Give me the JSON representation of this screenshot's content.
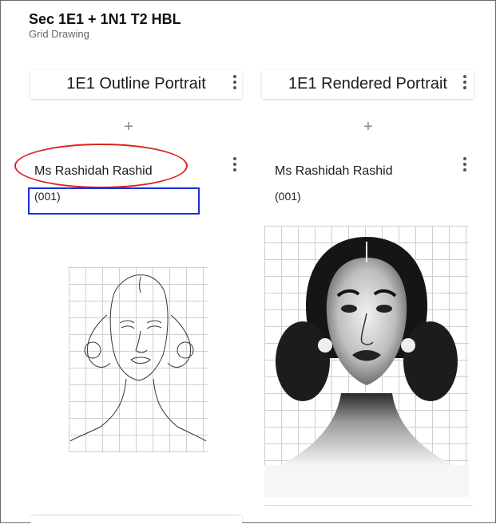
{
  "board": {
    "title": "Sec 1E1 + 1N1 T2 HBL",
    "subtitle": "Grid Drawing"
  },
  "columns": [
    {
      "title": "1E1 Outline Portrait",
      "add_symbol": "+",
      "posts": [
        {
          "author": "Ms Rashidah Rashid",
          "number": "(001)",
          "image": "outline-portrait-sketch"
        }
      ]
    },
    {
      "title": "1E1 Rendered Portrait",
      "add_symbol": "+",
      "posts": [
        {
          "author": "Ms Rashidah Rashid",
          "number": "(001)",
          "image": "rendered-portrait-drawing"
        }
      ]
    }
  ],
  "annotations": {
    "ellipse_color": "#d9231d",
    "rect_color": "#1b2ed8"
  },
  "icons": {
    "more": "kebab-vertical-icon",
    "add": "plus-icon"
  }
}
